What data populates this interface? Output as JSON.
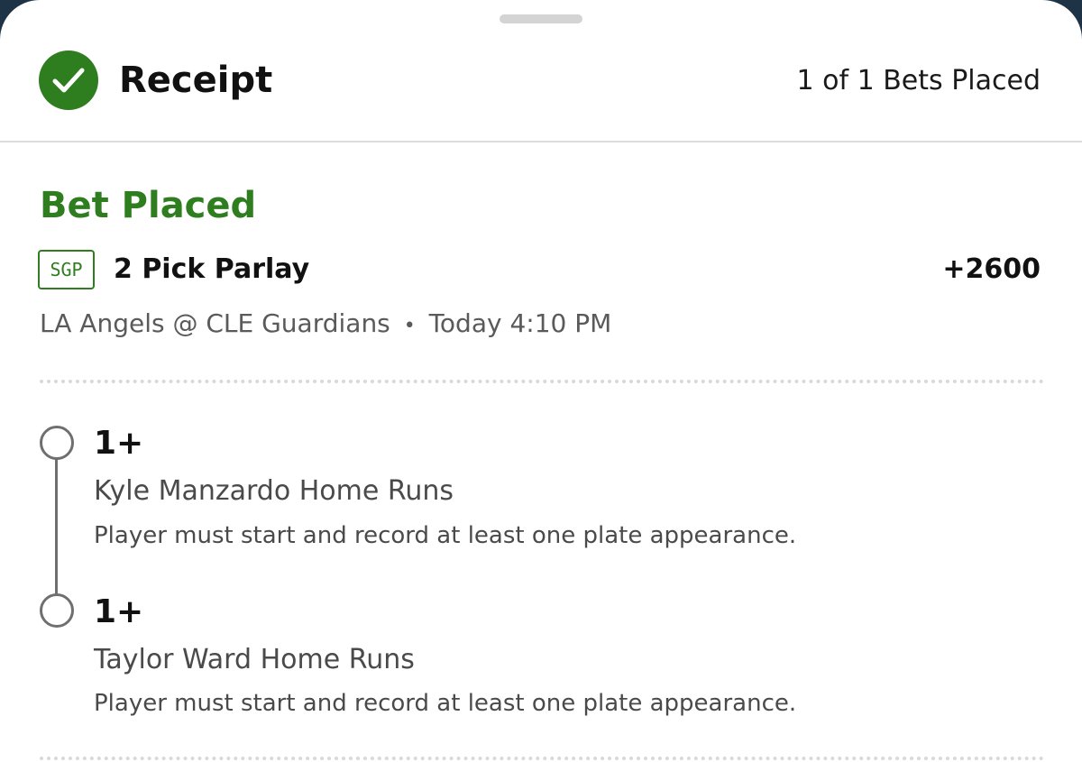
{
  "header": {
    "title": "Receipt",
    "bets_placed": "1 of 1 Bets Placed"
  },
  "bet": {
    "status": "Bet Placed",
    "badge": "SGP",
    "type": "2 Pick Parlay",
    "odds": "+2600",
    "matchup": "LA Angels @ CLE Guardians",
    "separator": "•",
    "time": "Today 4:10 PM"
  },
  "legs": [
    {
      "line": "1+",
      "market": "Kyle Manzardo Home Runs",
      "note": "Player must start and record at least one plate appearance."
    },
    {
      "line": "1+",
      "market": "Taylor Ward Home Runs",
      "note": "Player must start and record at least one plate appearance."
    }
  ],
  "colors": {
    "accent_green": "#2e7d1e",
    "backdrop": "#1f3346"
  },
  "icons": {
    "status": "check-circle-icon",
    "leg_marker": "empty-circle-icon"
  }
}
